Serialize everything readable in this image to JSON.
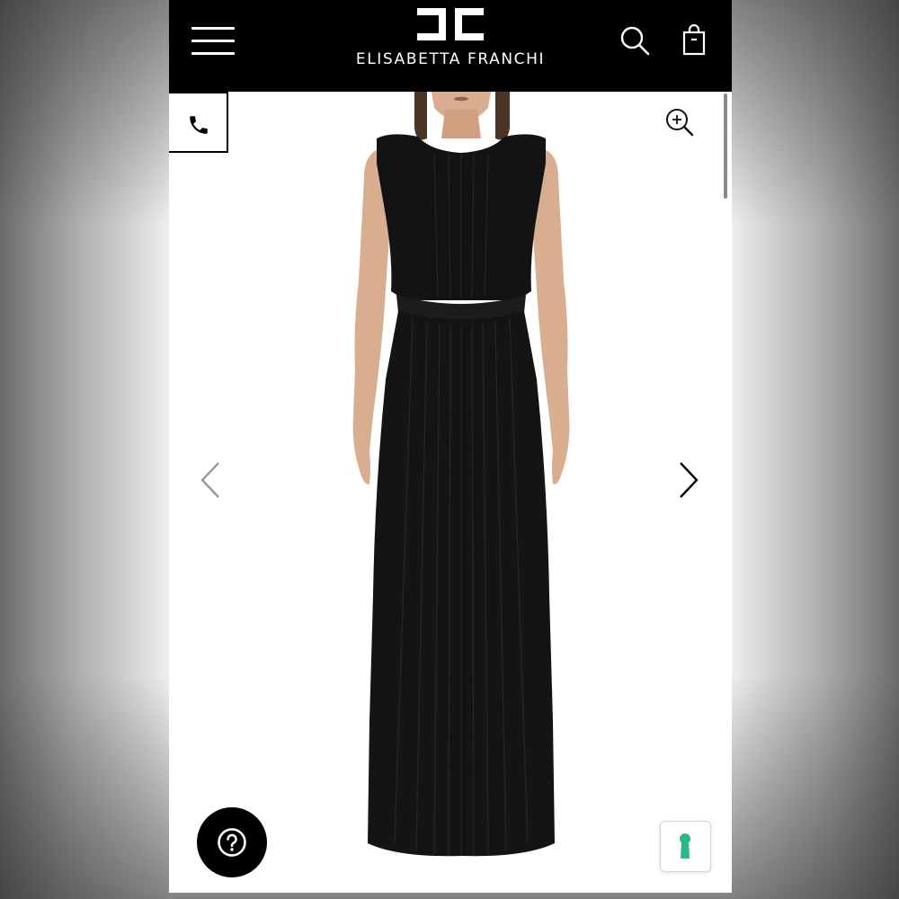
{
  "header": {
    "brand_name": "ELISABETTA FRANCHI",
    "logo_icon": "ef-monogram-logo",
    "menu_icon": "hamburger-menu-icon",
    "search_icon": "search-icon",
    "bag_icon": "shopping-bag-icon",
    "background_color": "#000000",
    "text_color": "#ffffff"
  },
  "gallery": {
    "call_icon": "phone-icon",
    "zoom_icon": "zoom-in-icon",
    "prev_icon": "chevron-left-icon",
    "next_icon": "chevron-right-icon",
    "product_image": "long-black-pleated-sleeveless-dress"
  },
  "floating": {
    "help_icon": "question-mark-icon",
    "accessibility_icon": "keyhole-icon",
    "accessibility_color": "#2bb88a"
  }
}
